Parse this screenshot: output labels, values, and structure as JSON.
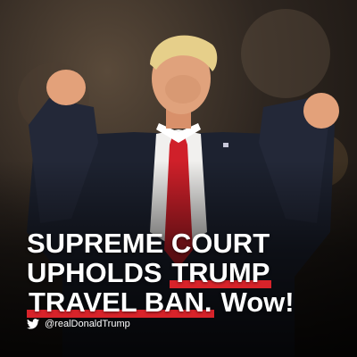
{
  "headline": {
    "line1": "SUPREME COURT",
    "line2_prefix": "UPHOLDS ",
    "line2_highlight": "TRUMP",
    "line3_highlight": "TRAVEL BAN.",
    "line3_suffix": "Wow!"
  },
  "credit": {
    "icon": "twitter-bird-icon",
    "handle": "@realDonaldTrump"
  },
  "colors": {
    "highlight": "#d8232a",
    "text": "#ffffff"
  }
}
